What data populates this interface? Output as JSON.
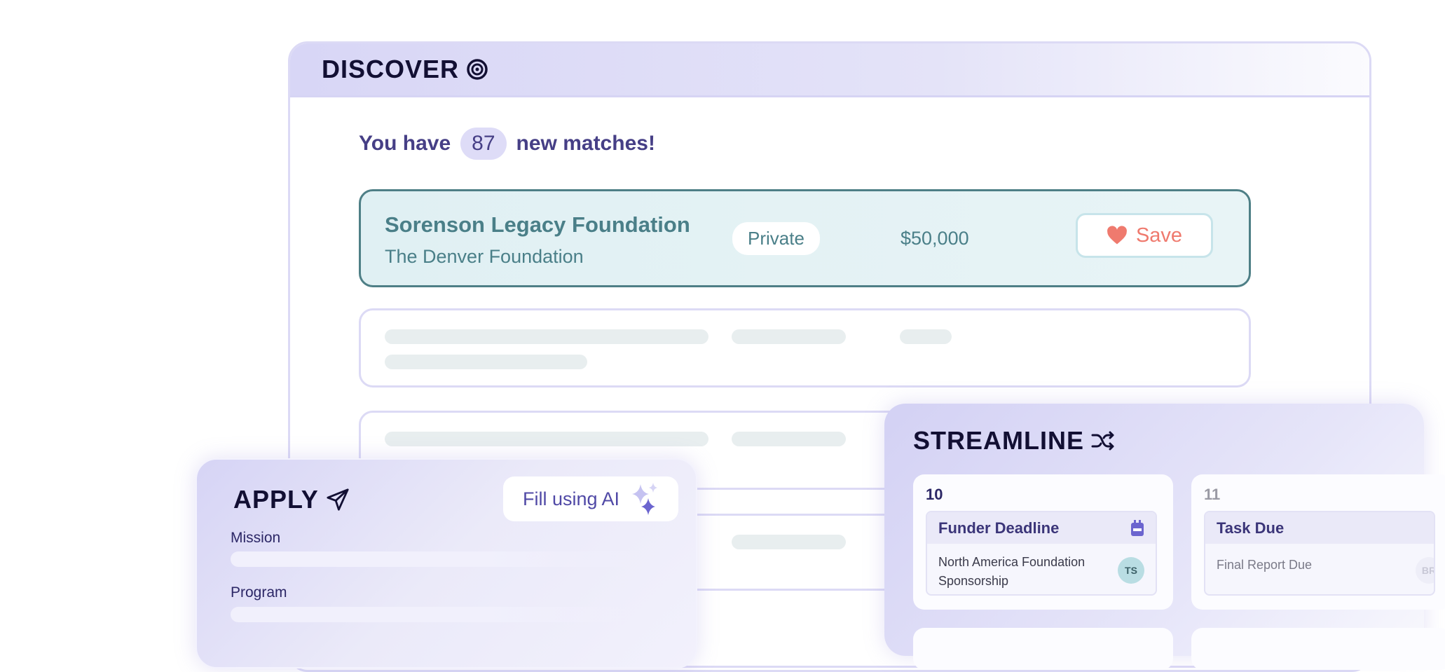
{
  "discover": {
    "title": "DISCOVER",
    "icon": "target-icon",
    "matches_prefix": "You have",
    "matches_count": "87",
    "matches_suffix": "new matches!",
    "featured": {
      "name": "Sorenson Legacy Foundation",
      "funder": "The Denver Foundation",
      "type": "Private",
      "amount": "$50,000",
      "save_label": "Save"
    }
  },
  "apply": {
    "title": "APPLY",
    "icon": "paper-plane-icon",
    "fill_ai_label": "Fill using AI",
    "fields": [
      {
        "label": "Mission"
      },
      {
        "label": "Program"
      }
    ]
  },
  "streamline": {
    "title": "STREAMLINE",
    "icon": "shuffle-icon",
    "days": [
      {
        "day": "10",
        "event": {
          "title": "Funder Deadline",
          "description": "North America Foundation Sponsorship",
          "assignee": "TS"
        }
      },
      {
        "day": "11",
        "event": {
          "title": "Task Due",
          "description": "Final Report Due",
          "assignee": "BR"
        }
      }
    ]
  },
  "colors": {
    "accent": "#463f86",
    "featured_text": "#4a7f88",
    "save": "#ef7a6e"
  }
}
